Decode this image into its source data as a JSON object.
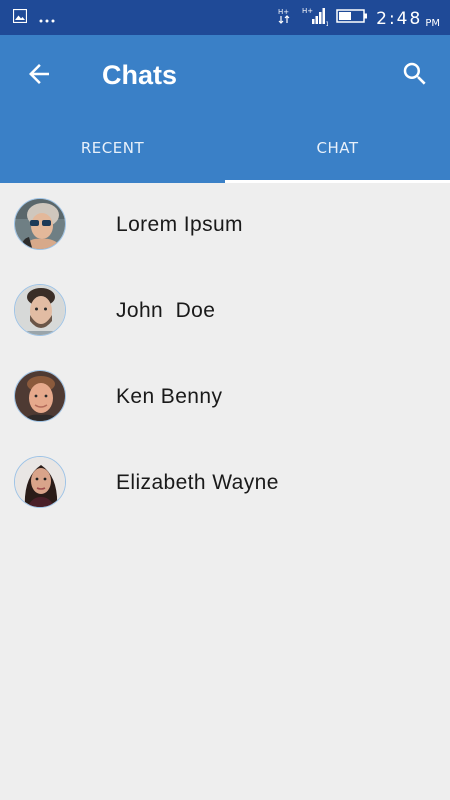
{
  "status_bar": {
    "time": "2:48",
    "ampm": "PM",
    "icons": [
      "image-icon",
      "more-dots-icon",
      "signal-h-plus-icon",
      "signal-bars-icon",
      "battery-icon"
    ]
  },
  "app_bar": {
    "title": "Chats",
    "back_icon": "arrow-back-icon",
    "search_icon": "search-icon",
    "background_color": "#3a80c7"
  },
  "tabs": [
    {
      "label": "RECENT",
      "selected": false
    },
    {
      "label": "CHAT",
      "selected": true
    }
  ],
  "contacts": [
    {
      "name": "Lorem Ipsum"
    },
    {
      "name": "John  Doe"
    },
    {
      "name": "Ken Benny"
    },
    {
      "name": "Elizabeth Wayne"
    }
  ],
  "colors": {
    "status_bar": "#1f4a97",
    "accent": "#3a80c7",
    "background": "#eeeeee"
  }
}
